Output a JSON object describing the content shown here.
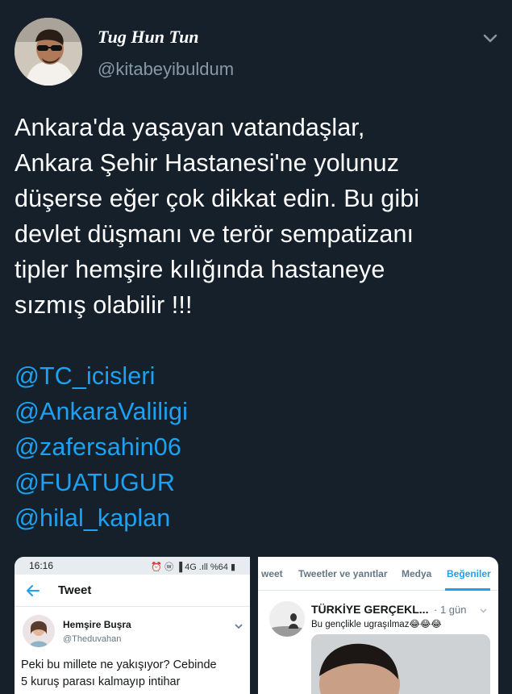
{
  "author": {
    "display_name": "Tug Hun Tun",
    "handle": "@kitabeyibuldum"
  },
  "tweet": {
    "lines": [
      "Ankara'da yaşayan vatandaşlar,",
      "Ankara Şehir Hastanesi'ne yolunuz",
      "düşerse eğer çok dikkat edin. Bu gibi",
      "devlet düşmanı ve terör sempatizanı",
      "tipler hemşire kılığında hastaneye",
      "sızmış olabilir !!!"
    ],
    "mentions": [
      "@TC_icisleri",
      "@AnkaraValiligi",
      "@zafersahin06",
      "@FUATUGUR",
      "@hilal_kaplan"
    ]
  },
  "media_left": {
    "status_time": "16:16",
    "status_icons": "⏰ ⓦ ▐ 4G .ıll %64 ▮",
    "header_title": "Tweet",
    "name": "Hemşire Buşra",
    "handle": "@Theduvahan",
    "text_lines": [
      "Peki bu millete ne yakışıyor? Cebinde",
      "5 kuruş parası kalmayıp intihar"
    ]
  },
  "media_right": {
    "tabs": [
      "weet",
      "Tweetler ve yanıtlar",
      "Medya",
      "Beğeniler"
    ],
    "active_tab": "Beğeniler",
    "name": "TÜRKİYE GERÇEKL...",
    "time": "· 1 gün",
    "text": "Bu gençlikle ugraşılmaz😂😂😂"
  },
  "colors": {
    "background": "#15202b",
    "text": "#ffffff",
    "secondary": "#8899a6",
    "mention": "#1da1f2"
  },
  "icons": {
    "menu": "chevron-down-icon",
    "back": "arrow-left-icon"
  }
}
